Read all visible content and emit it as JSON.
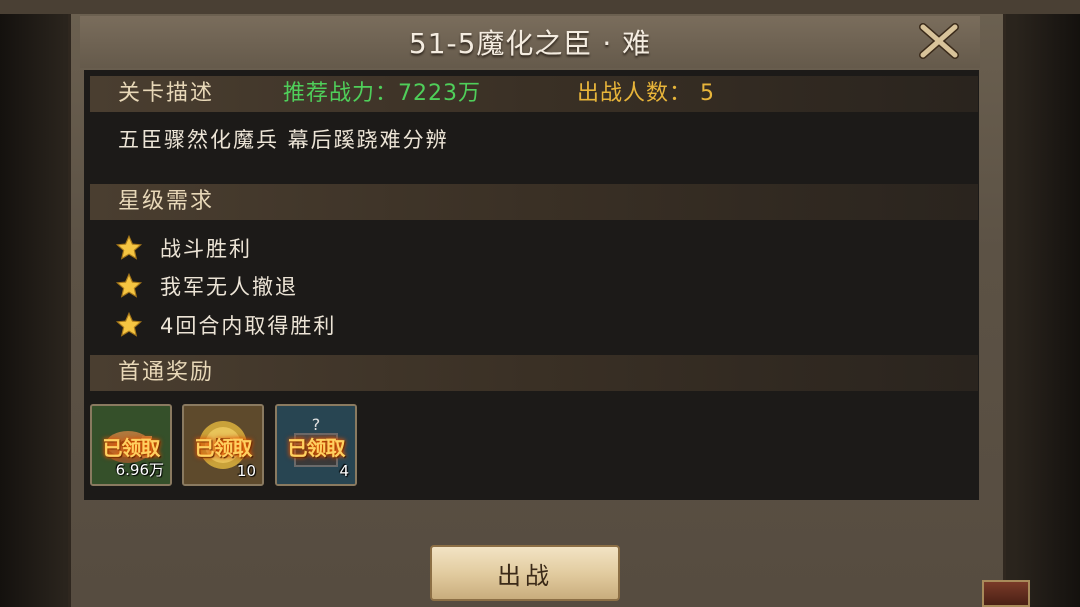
{
  "title": "51-5魔化之臣 · 难",
  "stage_info": {
    "section_label": "关卡描述",
    "recommended_power": "推荐战力：7223万",
    "troop_count": "出战人数： 5",
    "description": "五臣骤然化魔兵 幕后蹊跷难分辨"
  },
  "star_requirements": {
    "section_label": "星级需求",
    "items": [
      {
        "label": "战斗胜利"
      },
      {
        "label": "我军无人撤退"
      },
      {
        "label": "4回合内取得胜利"
      }
    ]
  },
  "first_clear_rewards": {
    "section_label": "首通奖励",
    "items": [
      {
        "status": "已领取",
        "count": "6.96万",
        "icon": "copper-coins-icon",
        "bg": "#3d5a2e"
      },
      {
        "status": "已领取",
        "count": "10",
        "icon": "gold-coin-icon",
        "bg": "#6a5232"
      },
      {
        "status": "已领取",
        "count": "4",
        "icon": "mystery-chest-icon",
        "bg": "#2c4a56"
      }
    ]
  },
  "battle_button": "出战",
  "colors": {
    "power_green": "#4fcf5a",
    "troop_gold": "#e8b53a",
    "star_gold": "#f5c542"
  }
}
